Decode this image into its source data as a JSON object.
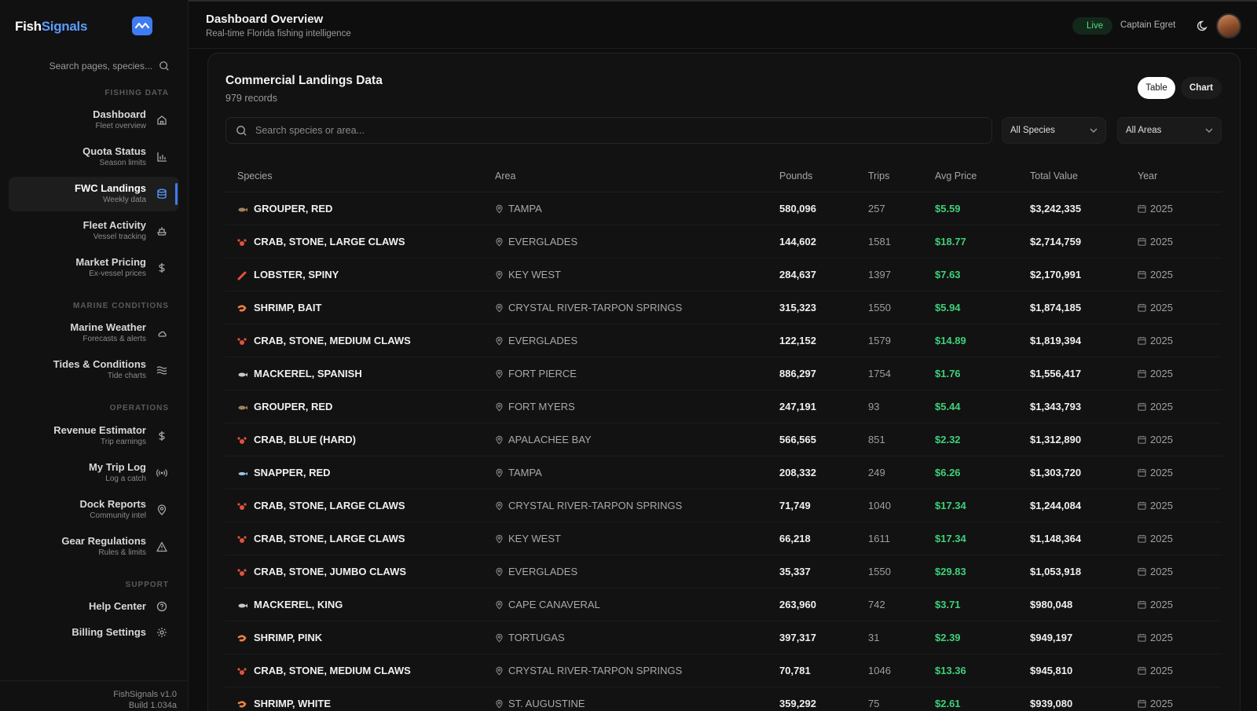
{
  "brand": {
    "name_a": "Fish",
    "name_b": "Signals"
  },
  "sidebar": {
    "search_placeholder": "Search pages, species...",
    "sections": [
      "FISHING DATA",
      "MARINE CONDITIONS",
      "OPERATIONS",
      "SUPPORT"
    ],
    "items": [
      {
        "title": "Dashboard",
        "sub": "Fleet overview",
        "icon": "home-icon"
      },
      {
        "title": "Quota Status",
        "sub": "Season limits",
        "icon": "bar-chart-icon"
      },
      {
        "title": "FWC Landings",
        "sub": "Weekly data",
        "icon": "database-icon"
      },
      {
        "title": "Fleet Activity",
        "sub": "Vessel tracking",
        "icon": "ship-icon"
      },
      {
        "title": "Market Pricing",
        "sub": "Ex-vessel prices",
        "icon": "dollar-icon"
      },
      {
        "title": "Marine Weather",
        "sub": "Forecasts & alerts",
        "icon": "cloud-icon"
      },
      {
        "title": "Tides & Conditions",
        "sub": "Tide charts",
        "icon": "waves-icon"
      },
      {
        "title": "Revenue Estimator",
        "sub": "Trip earnings",
        "icon": "dollar-icon"
      },
      {
        "title": "My Trip Log",
        "sub": "Log a catch",
        "icon": "radio-icon"
      },
      {
        "title": "Dock Reports",
        "sub": "Community intel",
        "icon": "map-pin-icon"
      },
      {
        "title": "Gear Regulations",
        "sub": "Rules & limits",
        "icon": "warning-icon"
      },
      {
        "title": "Help Center",
        "icon": "help-icon"
      },
      {
        "title": "Billing Settings",
        "icon": "gear-icon"
      }
    ],
    "footer": {
      "version": "FishSignals v1.0",
      "build": "Build 1.034a"
    }
  },
  "header": {
    "title": "Dashboard Overview",
    "subtitle": "Real-time Florida fishing intelligence",
    "live": "Live",
    "user": "Captain Egret"
  },
  "card": {
    "title": "Commercial Landings Data",
    "records": "979 records",
    "view_table": "Table",
    "view_chart": "Chart",
    "search_placeholder": "Search species or area...",
    "species_filter": "All Species",
    "area_filter": "All Areas"
  },
  "table": {
    "headers": [
      "Species",
      "Area",
      "Pounds",
      "Trips",
      "Avg Price",
      "Total Value",
      "Year"
    ],
    "rows": [
      {
        "species": "GROUPER, RED",
        "type": "fish-brown",
        "area": "TAMPA",
        "pounds": "580,096",
        "trips": "257",
        "price": "$5.59",
        "total": "$3,242,335",
        "year": "2025"
      },
      {
        "species": "CRAB, STONE, LARGE CLAWS",
        "type": "crab",
        "area": "EVERGLADES",
        "pounds": "144,602",
        "trips": "1581",
        "price": "$18.77",
        "total": "$2,714,759",
        "year": "2025"
      },
      {
        "species": "LOBSTER, SPINY",
        "type": "lobster",
        "area": "KEY WEST",
        "pounds": "284,637",
        "trips": "1397",
        "price": "$7.63",
        "total": "$2,170,991",
        "year": "2025"
      },
      {
        "species": "SHRIMP, BAIT",
        "type": "shrimp",
        "area": "CRYSTAL RIVER-TARPON SPRINGS",
        "pounds": "315,323",
        "trips": "1550",
        "price": "$5.94",
        "total": "$1,874,185",
        "year": "2025"
      },
      {
        "species": "CRAB, STONE, MEDIUM CLAWS",
        "type": "crab",
        "area": "EVERGLADES",
        "pounds": "122,152",
        "trips": "1579",
        "price": "$14.89",
        "total": "$1,819,394",
        "year": "2025"
      },
      {
        "species": "MACKEREL, SPANISH",
        "type": "fish-grey",
        "area": "FORT PIERCE",
        "pounds": "886,297",
        "trips": "1754",
        "price": "$1.76",
        "total": "$1,556,417",
        "year": "2025"
      },
      {
        "species": "GROUPER, RED",
        "type": "fish-brown",
        "area": "FORT MYERS",
        "pounds": "247,191",
        "trips": "93",
        "price": "$5.44",
        "total": "$1,343,793",
        "year": "2025"
      },
      {
        "species": "CRAB, BLUE (HARD)",
        "type": "crab",
        "area": "APALACHEE BAY",
        "pounds": "566,565",
        "trips": "851",
        "price": "$2.32",
        "total": "$1,312,890",
        "year": "2025"
      },
      {
        "species": "SNAPPER, RED",
        "type": "fish-blue",
        "area": "TAMPA",
        "pounds": "208,332",
        "trips": "249",
        "price": "$6.26",
        "total": "$1,303,720",
        "year": "2025"
      },
      {
        "species": "CRAB, STONE, LARGE CLAWS",
        "type": "crab",
        "area": "CRYSTAL RIVER-TARPON SPRINGS",
        "pounds": "71,749",
        "trips": "1040",
        "price": "$17.34",
        "total": "$1,244,084",
        "year": "2025"
      },
      {
        "species": "CRAB, STONE, LARGE CLAWS",
        "type": "crab",
        "area": "KEY WEST",
        "pounds": "66,218",
        "trips": "1611",
        "price": "$17.34",
        "total": "$1,148,364",
        "year": "2025"
      },
      {
        "species": "CRAB, STONE, JUMBO CLAWS",
        "type": "crab",
        "area": "EVERGLADES",
        "pounds": "35,337",
        "trips": "1550",
        "price": "$29.83",
        "total": "$1,053,918",
        "year": "2025"
      },
      {
        "species": "MACKEREL, KING",
        "type": "fish-grey",
        "area": "CAPE CANAVERAL",
        "pounds": "263,960",
        "trips": "742",
        "price": "$3.71",
        "total": "$980,048",
        "year": "2025"
      },
      {
        "species": "SHRIMP, PINK",
        "type": "shrimp",
        "area": "TORTUGAS",
        "pounds": "397,317",
        "trips": "31",
        "price": "$2.39",
        "total": "$949,197",
        "year": "2025"
      },
      {
        "species": "CRAB, STONE, MEDIUM CLAWS",
        "type": "crab",
        "area": "CRYSTAL RIVER-TARPON SPRINGS",
        "pounds": "70,781",
        "trips": "1046",
        "price": "$13.36",
        "total": "$945,810",
        "year": "2025"
      },
      {
        "species": "SHRIMP, WHITE",
        "type": "shrimp",
        "area": "ST. AUGUSTINE",
        "pounds": "359,292",
        "trips": "75",
        "price": "$2.61",
        "total": "$939,080",
        "year": "2025"
      }
    ]
  },
  "colors": {
    "accent": "#3f7cf2",
    "price_green": "#3fd07a",
    "live_green": "#4ade80"
  }
}
